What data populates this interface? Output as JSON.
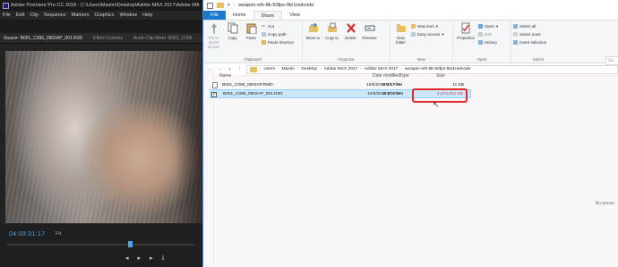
{
  "premiere": {
    "title": "Adobe Premiere Pro CC 2018 - C:\\Users\\Maxim\\Desktop\\Adobe MAX 2017\\Adobe MA",
    "menu": [
      "File",
      "Edit",
      "Clip",
      "Sequence",
      "Markers",
      "Graphics",
      "Window",
      "Help"
    ],
    "panel_tabs": [
      "Source: B001_C096_0902AP_001.R3D",
      "Effect Controls",
      "Audio Clip Mixer: B001_C096"
    ],
    "timecode": "04:09:31:17",
    "fit": "Fit",
    "accent_color": "#3ea6ff"
  },
  "explorer": {
    "title": "weapon-eth-8k-50fps-9to1redcode",
    "tabs": [
      "File",
      "Home",
      "Share",
      "View"
    ],
    "ribbon": {
      "clipboard": {
        "group_label": "Clipboard",
        "pin_label": "Pin to Quick access",
        "copy_label": "Copy",
        "paste_label": "Paste",
        "cut_label": "Cut",
        "copy_path_label": "Copy path",
        "paste_shortcut_label": "Paste shortcut"
      },
      "organize": {
        "group_label": "Organize",
        "move_to_label": "Move to",
        "copy_to_label": "Copy to",
        "delete_label": "Delete",
        "rename_label": "Rename"
      },
      "new": {
        "group_label": "New",
        "new_folder_label": "New folder",
        "new_item_label": "New item",
        "easy_access_label": "Easy access"
      },
      "open": {
        "group_label": "Open",
        "properties_label": "Properties",
        "open_label": "Open",
        "edit_label": "Edit",
        "history_label": "History"
      },
      "select": {
        "group_label": "Select",
        "select_all_label": "Select all",
        "select_none_label": "Select none",
        "invert_label": "Invert selection"
      }
    },
    "breadcrumb": [
      "Users",
      "Maxim",
      "Desktop",
      "Adobe MAX 2017",
      "Adobe MAX 2017",
      "weapon-eth-8k-50fps-9to1redcode"
    ],
    "search_placeholder": "Se",
    "columns": {
      "name": "Name",
      "date": "Date modified",
      "type": "Type",
      "size": "Size"
    },
    "files": [
      {
        "name": "B001_C096_0902AP.RMD",
        "date": "10/6/2016 2:17 AM",
        "type": "RMD File",
        "size": "11 KB",
        "selected": false
      },
      {
        "name": "B001_C096_0902AP_001.R3D",
        "date": "10/6/2016 2:17 AM",
        "type": "R3D File",
        "size": "2,373,624 KB",
        "selected": true
      }
    ],
    "empty_text": "No previe",
    "highlight_color": "#e0282a"
  }
}
